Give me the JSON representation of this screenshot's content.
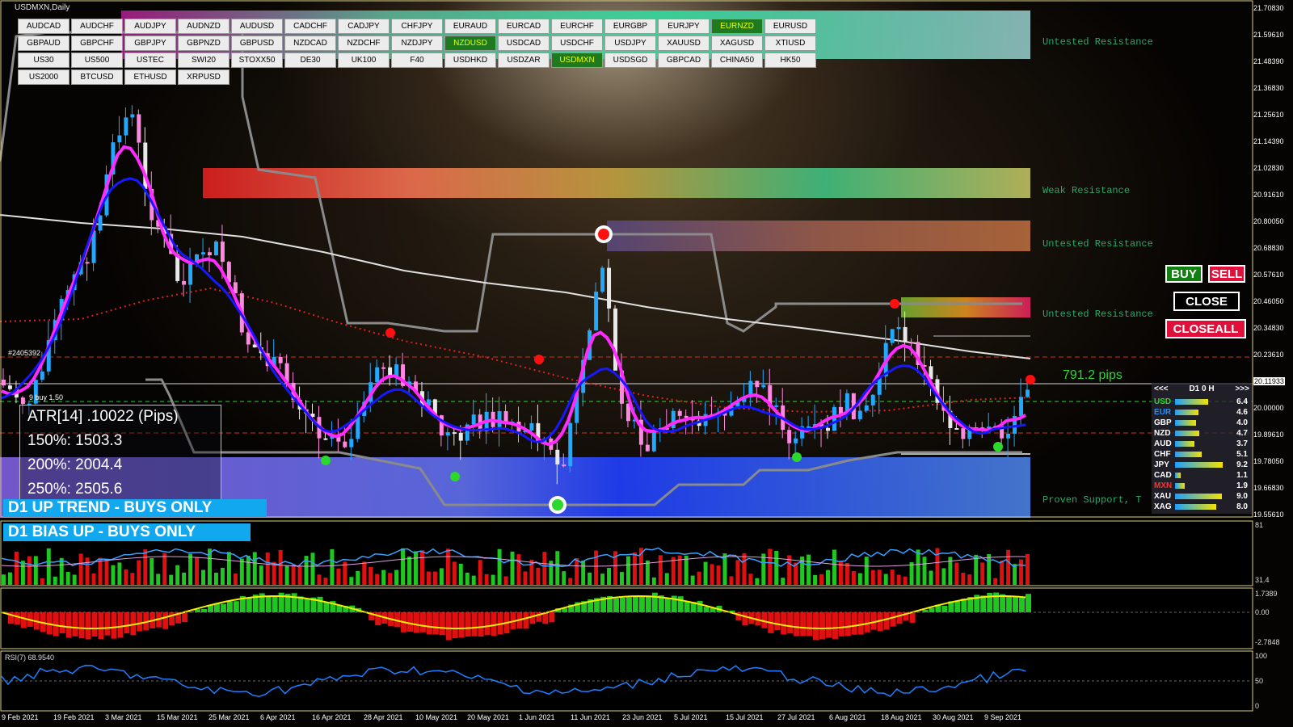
{
  "chart": {
    "title": "USDMXN,Daily",
    "pips_label": "791.2 pips",
    "left_marker_top": "#2405392",
    "left_marker_buy": "9 buy 1.50",
    "current_price": "20.11933"
  },
  "symbols": [
    {
      "label": "AUDCAD",
      "active": false
    },
    {
      "label": "AUDCHF",
      "active": false
    },
    {
      "label": "AUDJPY",
      "active": false
    },
    {
      "label": "AUDNZD",
      "active": false
    },
    {
      "label": "AUDUSD",
      "active": false
    },
    {
      "label": "CADCHF",
      "active": false
    },
    {
      "label": "CADJPY",
      "active": false
    },
    {
      "label": "CHFJPY",
      "active": false
    },
    {
      "label": "EURAUD",
      "active": false
    },
    {
      "label": "EURCAD",
      "active": false
    },
    {
      "label": "EURCHF",
      "active": false
    },
    {
      "label": "EURGBP",
      "active": false
    },
    {
      "label": "EURJPY",
      "active": false
    },
    {
      "label": "EURNZD",
      "active": true
    },
    {
      "label": "EURUSD",
      "active": false
    },
    {
      "label": "GBPAUD",
      "active": false
    },
    {
      "label": "GBPCHF",
      "active": false
    },
    {
      "label": "GBPJPY",
      "active": false
    },
    {
      "label": "GBPNZD",
      "active": false
    },
    {
      "label": "GBPUSD",
      "active": false
    },
    {
      "label": "NZDCAD",
      "active": false
    },
    {
      "label": "NZDCHF",
      "active": false
    },
    {
      "label": "NZDJPY",
      "active": false
    },
    {
      "label": "NZDUSD",
      "active": true
    },
    {
      "label": "USDCAD",
      "active": false
    },
    {
      "label": "USDCHF",
      "active": false
    },
    {
      "label": "USDJPY",
      "active": false
    },
    {
      "label": "XAUUSD",
      "active": false
    },
    {
      "label": "XAGUSD",
      "active": false
    },
    {
      "label": "XTIUSD",
      "active": false
    },
    {
      "label": "US30",
      "active": false
    },
    {
      "label": "US500",
      "active": false
    },
    {
      "label": "USTEC",
      "active": false
    },
    {
      "label": "SWI20",
      "active": false
    },
    {
      "label": "STOXX50",
      "active": false
    },
    {
      "label": "DE30",
      "active": false
    },
    {
      "label": "UK100",
      "active": false
    },
    {
      "label": "F40",
      "active": false
    },
    {
      "label": "USDHKD",
      "active": false
    },
    {
      "label": "USDZAR",
      "active": false
    },
    {
      "label": "USDMXN",
      "active": true
    },
    {
      "label": "USDSGD",
      "active": false
    },
    {
      "label": "GBPCAD",
      "active": false
    },
    {
      "label": "CHINA50",
      "active": false
    },
    {
      "label": "HK50",
      "active": false
    },
    {
      "label": "US2000",
      "active": false
    },
    {
      "label": "BTCUSD",
      "active": false
    },
    {
      "label": "ETHUSD",
      "active": false
    },
    {
      "label": "XRPUSD",
      "active": false
    }
  ],
  "trade_buttons": {
    "buy": "BUY",
    "sell": "SELL",
    "close": "CLOSE",
    "closeall": "CLOSEALL"
  },
  "atr": {
    "line1": "ATR[14] .10022  (Pips)",
    "line2": "150%: 1503.3",
    "line3": "200%: 2004.4",
    "line4": "250%: 2505.6"
  },
  "banners": {
    "trend": "D1 UP TREND - BUYS ONLY",
    "bias": "D1  BIAS UP - BUYS ONLY"
  },
  "zones": {
    "z1": "Untested Resistance",
    "z2": "Weak Resistance",
    "z3": "Untested Resistance",
    "z4": "Untested Resistance",
    "z5": "Proven Support, T"
  },
  "strength": {
    "nav_left": "<<<",
    "timeframe": "D1  0  H",
    "nav_right": ">>>",
    "rows": [
      {
        "cur": "USD",
        "val": "6.4",
        "level": 0.64,
        "color": "#2bd82b"
      },
      {
        "cur": "EUR",
        "val": "4.6",
        "level": 0.46,
        "color": "#1e90ff"
      },
      {
        "cur": "GBP",
        "val": "4.0",
        "level": 0.4,
        "color": "#ffffff"
      },
      {
        "cur": "NZD",
        "val": "4.7",
        "level": 0.47,
        "color": "#ffffff"
      },
      {
        "cur": "AUD",
        "val": "3.7",
        "level": 0.37,
        "color": "#ffffff"
      },
      {
        "cur": "CHF",
        "val": "5.1",
        "level": 0.51,
        "color": "#ffffff"
      },
      {
        "cur": "JPY",
        "val": "9.2",
        "level": 0.92,
        "color": "#ffffff"
      },
      {
        "cur": "CAD",
        "val": "1.1",
        "level": 0.11,
        "color": "#ffffff"
      },
      {
        "cur": "MXN",
        "val": "1.9",
        "level": 0.19,
        "color": "#ff3030"
      },
      {
        "cur": "XAU",
        "val": "9.0",
        "level": 0.9,
        "color": "#ffffff"
      },
      {
        "cur": "XAG",
        "val": "8.0",
        "level": 0.8,
        "color": "#ffffff"
      }
    ]
  },
  "price_axis": [
    "21.70830",
    "21.59610",
    "21.48390",
    "21.36830",
    "21.25610",
    "21.14390",
    "21.02830",
    "20.91610",
    "20.80050",
    "20.68830",
    "20.57610",
    "20.46050",
    "20.34830",
    "20.23610",
    "20.11933",
    "20.00000",
    "19.89610",
    "19.78050",
    "19.66830",
    "19.55610"
  ],
  "time_axis": [
    "9 Feb 2021",
    "19 Feb 2021",
    "3 Mar 2021",
    "15 Mar 2021",
    "25 Mar 2021",
    "6 Apr 2021",
    "16 Apr 2021",
    "28 Apr 2021",
    "10 May 2021",
    "20 May 2021",
    "1 Jun 2021",
    "11 Jun 2021",
    "23 Jun 2021",
    "5 Jul 2021",
    "15 Jul 2021",
    "27 Jul 2021",
    "6 Aug 2021",
    "18 Aug 2021",
    "30 Aug 2021",
    "9 Sep 2021"
  ],
  "indicators": {
    "sub1_top": "81",
    "sub1_bottom": "31.4",
    "sub2_top": "1.7389",
    "sub2_mid": "0.00",
    "sub2_bottom": "-2.7848",
    "rsi_label": "RSI(7) 68.9540",
    "rsi_top": "100",
    "rsi_mid": "50",
    "rsi_bottom": "0"
  }
}
